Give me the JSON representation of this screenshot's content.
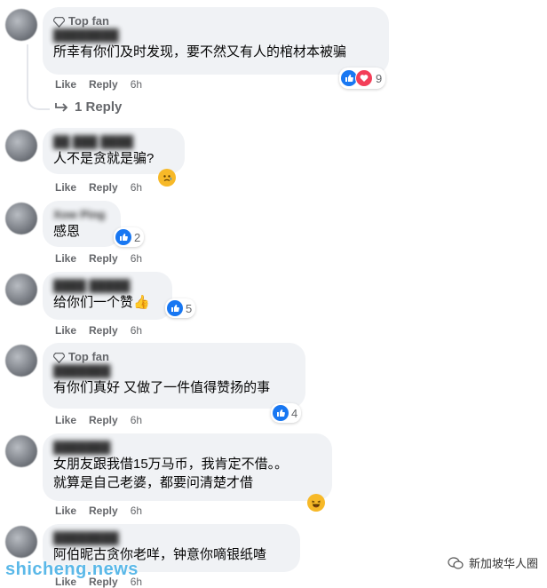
{
  "comments": [
    {
      "badge": "Top fan",
      "name": "████████",
      "text": "所幸有你们及时发现，要不然又有人的棺材本被骗",
      "like": "Like",
      "reply": "Reply",
      "time": "6h",
      "reactions": {
        "icons": [
          "like-icon",
          "love-icon"
        ],
        "count": "9"
      }
    },
    {
      "badge": "",
      "name": "██ ███ ████",
      "text": "人不是贪就是骗?",
      "like": "Like",
      "reply": "Reply",
      "time": "6h",
      "reactions": {
        "icons": [
          "sad-care-icon"
        ],
        "count": ""
      }
    },
    {
      "badge": "",
      "name": "Xow Ping",
      "text": "感恩",
      "like": "Like",
      "reply": "Reply",
      "time": "6h",
      "reactions": {
        "icons": [
          "like-icon"
        ],
        "count": "2"
      }
    },
    {
      "badge": "",
      "name": "████ █████",
      "text": "给你们一个赞👍",
      "like": "Like",
      "reply": "Reply",
      "time": "6h",
      "reactions": {
        "icons": [
          "like-icon"
        ],
        "count": "5"
      }
    },
    {
      "badge": "Top fan",
      "name": "███████",
      "text": "有你们真好 又做了一件值得赞扬的事",
      "like": "Like",
      "reply": "Reply",
      "time": "6h",
      "reactions": {
        "icons": [
          "like-icon"
        ],
        "count": "4"
      }
    },
    {
      "badge": "",
      "name": "███████",
      "text": "女朋友跟我借15万马币，我肯定不借。。\n就算是自己老婆，都要问清楚才借",
      "like": "Like",
      "reply": "Reply",
      "time": "6h",
      "reactions": {
        "icons": [
          "laugh-icon"
        ],
        "count": ""
      }
    },
    {
      "badge": "",
      "name": "████████",
      "text": "阿伯昵古贪你老咩，钟意你嘀银纸喳",
      "like": "Like",
      "reply": "Reply",
      "time": "6h",
      "reactions": {
        "icons": [],
        "count": ""
      }
    }
  ],
  "view_replies": "1 Reply",
  "watermark_left": "shicheng.news",
  "watermark_right": "新加坡华人圈",
  "colors": {
    "like": "#1877f2",
    "love": "#f33e58",
    "emoji": "#f7b928",
    "bubble": "#f0f2f5",
    "meta": "#65676b"
  }
}
